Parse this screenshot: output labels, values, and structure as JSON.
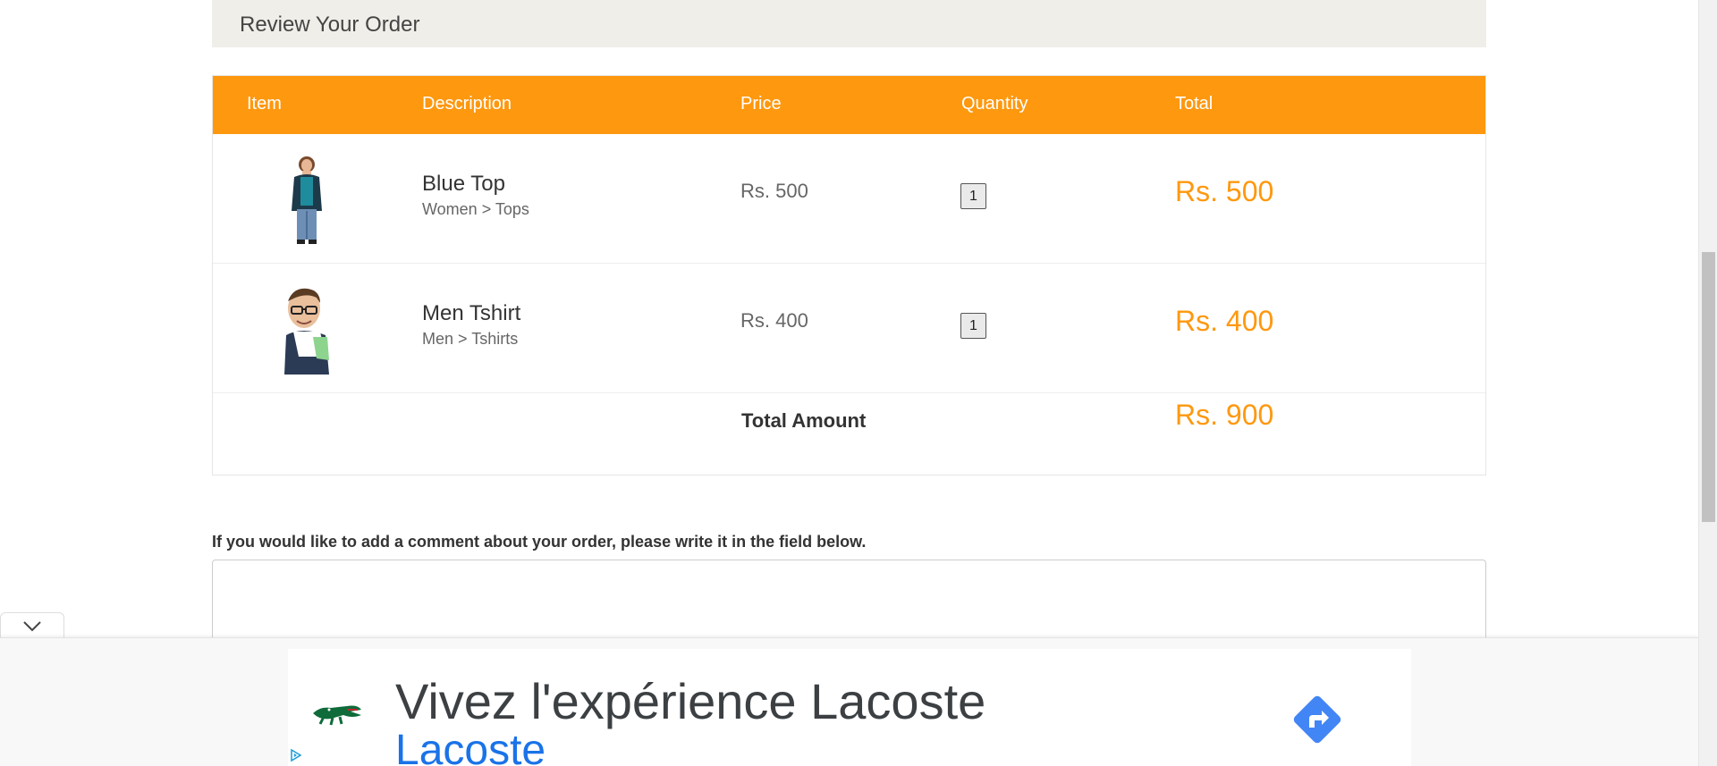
{
  "review": {
    "title": "Review Your Order"
  },
  "table": {
    "headers": {
      "item": "Item",
      "description": "Description",
      "price": "Price",
      "quantity": "Quantity",
      "total": "Total"
    },
    "rows": [
      {
        "image": "woman-in-blue-top-photo",
        "name": "Blue Top",
        "category": "Women > Tops",
        "price": "Rs. 500",
        "quantity": "1",
        "total": "Rs. 500"
      },
      {
        "image": "man-in-tshirt-photo",
        "name": "Men Tshirt",
        "category": "Men > Tshirts",
        "price": "Rs. 400",
        "quantity": "1",
        "total": "Rs. 400"
      }
    ],
    "total_label": "Total Amount",
    "total_value": "Rs. 900"
  },
  "comment": {
    "label": "If you would like to add a comment about your order, please write it in the field below.",
    "value": ""
  },
  "ad": {
    "headline": "Vivez l'expérience Lacoste",
    "brand": "Lacoste",
    "logo": "crocodile-logo",
    "cta_icon": "directions-arrow-icon",
    "collapse_icon": "chevron-down-icon",
    "choices_icon": "adchoices-icon"
  },
  "colors": {
    "accent": "#fe980f",
    "heading_bg": "#efeee9",
    "ad_link": "#1a73e8"
  }
}
